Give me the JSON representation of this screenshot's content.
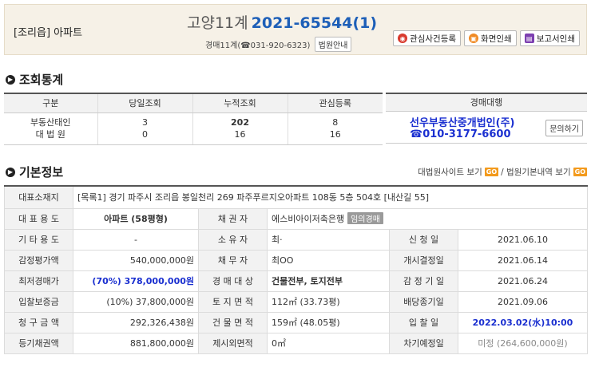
{
  "header": {
    "property_type": "[조리읍] 아파트",
    "title_court": "고양11계",
    "title_case": "2021-65544(1)",
    "court_line": "경매11계(☎031-920-6323)",
    "court_guide_btn": "법원안내",
    "buttons": [
      {
        "label": "관심사건등록",
        "icon": "alarm-icon"
      },
      {
        "label": "화면인쇄",
        "icon": "print-icon"
      },
      {
        "label": "보고서인쇄",
        "icon": "report-icon"
      }
    ]
  },
  "stats": {
    "title": "조회통계",
    "headers": [
      "구분",
      "당일조회",
      "누적조회",
      "관심등록"
    ],
    "rows": [
      {
        "label": "부동산태인",
        "today": "3",
        "total": "202",
        "interest": "8"
      },
      {
        "label": "대 법 원",
        "today": "0",
        "total": "16",
        "interest": "16"
      }
    ]
  },
  "agent": {
    "header": "경매대행",
    "name": "선우부동산중개법인(주)",
    "tel": "☎010-3177-6600",
    "inquiry_btn": "문의하기"
  },
  "basic": {
    "title": "기본정보",
    "link1": "대법원사이트 보기",
    "link2": "/ 법원기본내역 보기",
    "go": "GO",
    "address_label": "대표소재지",
    "address": "[목록1] 경기 파주시 조리읍 봉일천리 269 파주푸르지오아파트 108동 5층 504호 [내산길 55]",
    "rows": [
      {
        "l1": "대 표 용 도",
        "v1": "아파트 (58평형)",
        "l2": "채 권 자",
        "v2": "에스비아이저축은행",
        "v2_tag": "임의경매",
        "l3": "",
        "v3": ""
      },
      {
        "l1": "기 타 용 도",
        "v1": "-",
        "l2": "소 유 자",
        "v2": "최·",
        "l3": "신 청 일",
        "v3": "2021.06.10"
      },
      {
        "l1": "감정평가액",
        "v1": "540,000,000원",
        "l2": "채 무 자",
        "v2": "최OO",
        "l3": "개시결정일",
        "v3": "2021.06.14"
      },
      {
        "l1": "최저경매가",
        "v1": "(70%) 378,000,000원",
        "l2": "경 매 대 상",
        "v2": "건물전부, 토지전부",
        "l3": "감 정 기 일",
        "v3": "2021.06.24"
      },
      {
        "l1": "입찰보증금",
        "v1": "(10%) 37,800,000원",
        "l2": "토 지 면 적",
        "v2": "112㎡ (33.73평)",
        "l3": "배당종기일",
        "v3": "2021.09.06"
      },
      {
        "l1": "청 구 금 액",
        "v1": "292,326,438원",
        "l2": "건 물 면 적",
        "v2": "159㎡ (48.05평)",
        "l3": "입 찰 일",
        "v3": "2022.03.02(水)10:00"
      },
      {
        "l1": "등기채권액",
        "v1": "881,800,000원",
        "l2": "제시외면적",
        "v2": "0㎡",
        "l3": "차기예정일",
        "v3": "미정 (264,600,000원)"
      }
    ]
  }
}
